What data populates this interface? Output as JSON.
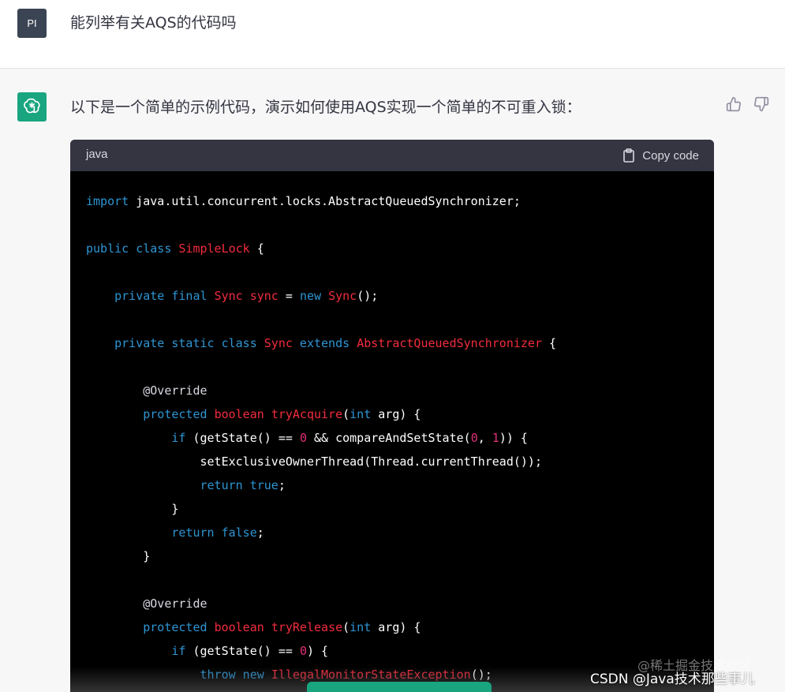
{
  "user": {
    "avatar_text": "PI",
    "message": "能列举有关AQS的代码吗"
  },
  "assistant": {
    "intro": "以下是一个简单的示例代码，演示如何使用AQS实现一个简单的不可重入锁："
  },
  "code_block": {
    "language": "java",
    "copy_label": "Copy code",
    "lines": [
      [
        [
          "kw",
          "import"
        ],
        [
          "plain",
          " java.util.concurrent.locks.AbstractQueuedSynchronizer;"
        ]
      ],
      [],
      [
        [
          "kw",
          "public class "
        ],
        [
          "ty",
          "SimpleLock"
        ],
        [
          "plain",
          " {"
        ]
      ],
      [],
      [
        [
          "plain",
          "    "
        ],
        [
          "kw",
          "private final "
        ],
        [
          "ty",
          "Sync sync"
        ],
        [
          "plain",
          " = "
        ],
        [
          "kw",
          "new "
        ],
        [
          "ty",
          "Sync"
        ],
        [
          "plain",
          "();"
        ]
      ],
      [],
      [
        [
          "plain",
          "    "
        ],
        [
          "kw",
          "private static class "
        ],
        [
          "ty",
          "Sync"
        ],
        [
          "kw",
          " extends "
        ],
        [
          "ty",
          "AbstractQueuedSynchronizer"
        ],
        [
          "plain",
          " {"
        ]
      ],
      [],
      [
        [
          "plain",
          "        "
        ],
        [
          "ann",
          "@Override"
        ]
      ],
      [
        [
          "plain",
          "        "
        ],
        [
          "kw",
          "protected "
        ],
        [
          "ty",
          "boolean "
        ],
        [
          "ty",
          "tryAcquire"
        ],
        [
          "plain",
          "("
        ],
        [
          "kw",
          "int"
        ],
        [
          "plain",
          " arg) {"
        ]
      ],
      [
        [
          "plain",
          "            "
        ],
        [
          "kw",
          "if"
        ],
        [
          "plain",
          " (getState() == "
        ],
        [
          "num",
          "0"
        ],
        [
          "plain",
          " && compareAndSetState("
        ],
        [
          "num",
          "0"
        ],
        [
          "plain",
          ", "
        ],
        [
          "num",
          "1"
        ],
        [
          "plain",
          ")) {"
        ]
      ],
      [
        [
          "plain",
          "                setExclusiveOwnerThread(Thread.currentThread());"
        ]
      ],
      [
        [
          "plain",
          "                "
        ],
        [
          "kw",
          "return true"
        ],
        [
          "plain",
          ";"
        ]
      ],
      [
        [
          "plain",
          "            }"
        ]
      ],
      [
        [
          "plain",
          "            "
        ],
        [
          "kw",
          "return false"
        ],
        [
          "plain",
          ";"
        ]
      ],
      [
        [
          "plain",
          "        }"
        ]
      ],
      [],
      [
        [
          "plain",
          "        "
        ],
        [
          "ann",
          "@Override"
        ]
      ],
      [
        [
          "plain",
          "        "
        ],
        [
          "kw",
          "protected "
        ],
        [
          "ty",
          "boolean "
        ],
        [
          "ty",
          "tryRelease"
        ],
        [
          "plain",
          "("
        ],
        [
          "kw",
          "int"
        ],
        [
          "plain",
          " arg) {"
        ]
      ],
      [
        [
          "plain",
          "            "
        ],
        [
          "kw",
          "if"
        ],
        [
          "plain",
          " (getState() == "
        ],
        [
          "num",
          "0"
        ],
        [
          "plain",
          ") {"
        ]
      ],
      [
        [
          "plain",
          "                "
        ],
        [
          "kw",
          "throw new "
        ],
        [
          "ty",
          "IllegalMonitorStateException"
        ],
        [
          "plain",
          "();"
        ]
      ],
      [
        [
          "plain",
          "            }"
        ]
      ]
    ]
  },
  "watermark": {
    "line1": "@稀土掘金技术社区",
    "line2": "CSDN @Java技术那些事儿"
  },
  "colors": {
    "keyword": "#2e95d3",
    "type": "#f22c3d",
    "number": "#df3079",
    "accent": "#19a57f"
  }
}
